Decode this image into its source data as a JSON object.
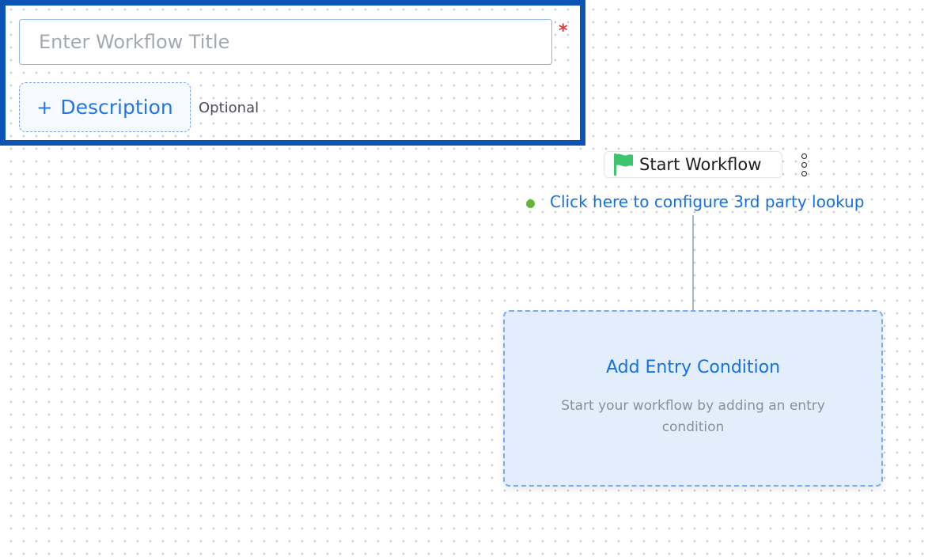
{
  "form": {
    "title_placeholder": "Enter Workflow Title",
    "title_value": "",
    "required_marker": "*",
    "description_button_plus": "+",
    "description_button_label": "Description",
    "optional_label": "Optional"
  },
  "workflow": {
    "start_node_label": "Start Workflow",
    "lookup_link_label": "Click here to configure 3rd party lookup",
    "entry_card_title": "Add Entry Condition",
    "entry_card_subtitle": "Start your workflow by adding an entry condition"
  },
  "icons": {
    "start_flag": "flag-icon",
    "node_menu": "kebab-menu-icon",
    "lookup_status": "status-dot-icon"
  },
  "colors": {
    "panel_border": "#0b54b5",
    "accent_blue": "#1f78e6",
    "link_blue": "#1570e2",
    "required_red": "#e53935",
    "flag_green": "#3cc46e",
    "status_green": "#62b63a",
    "card_background": "#e3eefc"
  }
}
